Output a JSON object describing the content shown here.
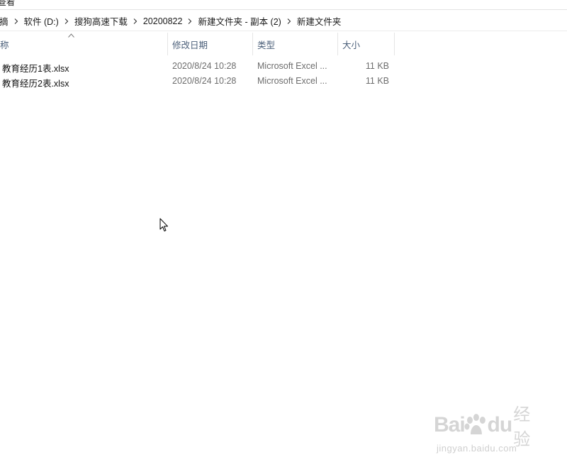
{
  "ribbon": {
    "menu_label": "查看"
  },
  "address_bar": {
    "crumbs": [
      "摘",
      "软件 (D:)",
      "搜狗高速下载",
      "20200822",
      "新建文件夹 - 副本 (2)",
      "新建文件夹"
    ]
  },
  "columns": {
    "name": "称",
    "date": "修改日期",
    "type": "类型",
    "size": "大小"
  },
  "files": [
    {
      "name": "教育经历1表.xlsx",
      "date": "2020/8/24 10:28",
      "type": "Microsoft Excel ...",
      "size": "11 KB"
    },
    {
      "name": "教育经历2表.xlsx",
      "date": "2020/8/24 10:28",
      "type": "Microsoft Excel ...",
      "size": "11 KB"
    }
  ],
  "watermark": {
    "brand_left": "Bai",
    "brand_right": "du",
    "brand_cn": "经验",
    "url": "jingyan.baidu.com"
  },
  "colors": {
    "header_text": "#4c607a",
    "hover": "#e5f3ff"
  }
}
